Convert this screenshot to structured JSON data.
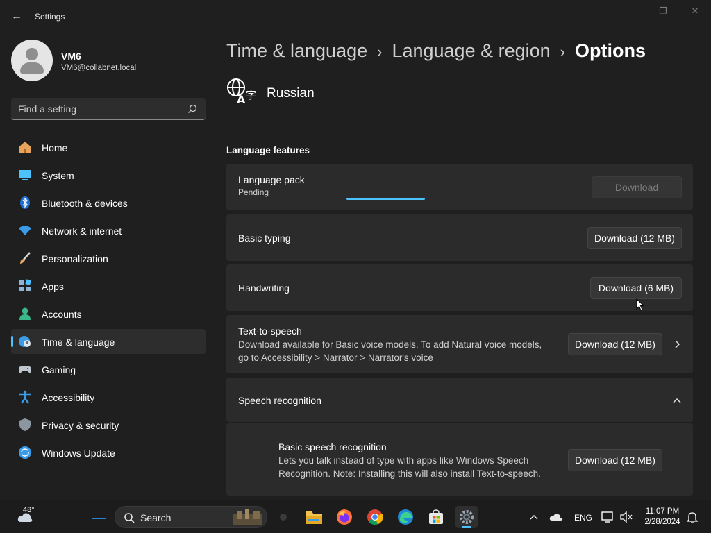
{
  "window": {
    "title": "Settings",
    "back_glyph": "←",
    "minimize_glyph": "—",
    "restore_glyph": "❐",
    "close_glyph": "✕"
  },
  "profile": {
    "name": "VM6",
    "email": "VM6@collabnet.local"
  },
  "search": {
    "placeholder": "Find a setting"
  },
  "sidebar": {
    "items": [
      {
        "label": "Home",
        "icon": "home-icon"
      },
      {
        "label": "System",
        "icon": "system-icon"
      },
      {
        "label": "Bluetooth & devices",
        "icon": "bluetooth-icon"
      },
      {
        "label": "Network & internet",
        "icon": "wifi-icon"
      },
      {
        "label": "Personalization",
        "icon": "brush-icon"
      },
      {
        "label": "Apps",
        "icon": "apps-icon"
      },
      {
        "label": "Accounts",
        "icon": "accounts-icon"
      },
      {
        "label": "Time & language",
        "icon": "globe-clock-icon",
        "active": true
      },
      {
        "label": "Gaming",
        "icon": "gamepad-icon"
      },
      {
        "label": "Accessibility",
        "icon": "accessibility-icon"
      },
      {
        "label": "Privacy & security",
        "icon": "shield-icon"
      },
      {
        "label": "Windows Update",
        "icon": "update-icon"
      }
    ]
  },
  "breadcrumb": {
    "part1": "Time & language",
    "part2": "Language & region",
    "current": "Options",
    "separator": "›"
  },
  "language": {
    "name": "Russian"
  },
  "features": {
    "section_title": "Language features",
    "language_pack": {
      "title": "Language pack",
      "status": "Pending",
      "button": "Download",
      "progress_state": "indeterminate"
    },
    "basic_typing": {
      "title": "Basic typing",
      "button": "Download (12 MB)"
    },
    "handwriting": {
      "title": "Handwriting",
      "button": "Download (6 MB)"
    },
    "tts": {
      "title": "Text-to-speech",
      "desc_line1": "Download available for Basic voice models. To add Natural voice models,",
      "desc_line2": "go to Accessibility > Narrator > Narrator's voice",
      "button": "Download (12 MB)"
    },
    "speech": {
      "title": "Speech recognition",
      "expanded": true
    },
    "basic_speech": {
      "title": "Basic speech recognition",
      "desc_line1": "Lets you talk instead of type with apps like Windows Speech",
      "desc_line2": "Recognition. Note: Installing this will also install Text-to-speech.",
      "button": "Download (12 MB)"
    }
  },
  "taskbar": {
    "weather_temp": "48°",
    "search_label": "Search",
    "language": "ENG",
    "time": "11:07 PM",
    "date": "2/28/2024"
  },
  "colors": {
    "accent": "#4cc2ff",
    "background": "#1f1f1f",
    "card": "#2b2b2b"
  }
}
